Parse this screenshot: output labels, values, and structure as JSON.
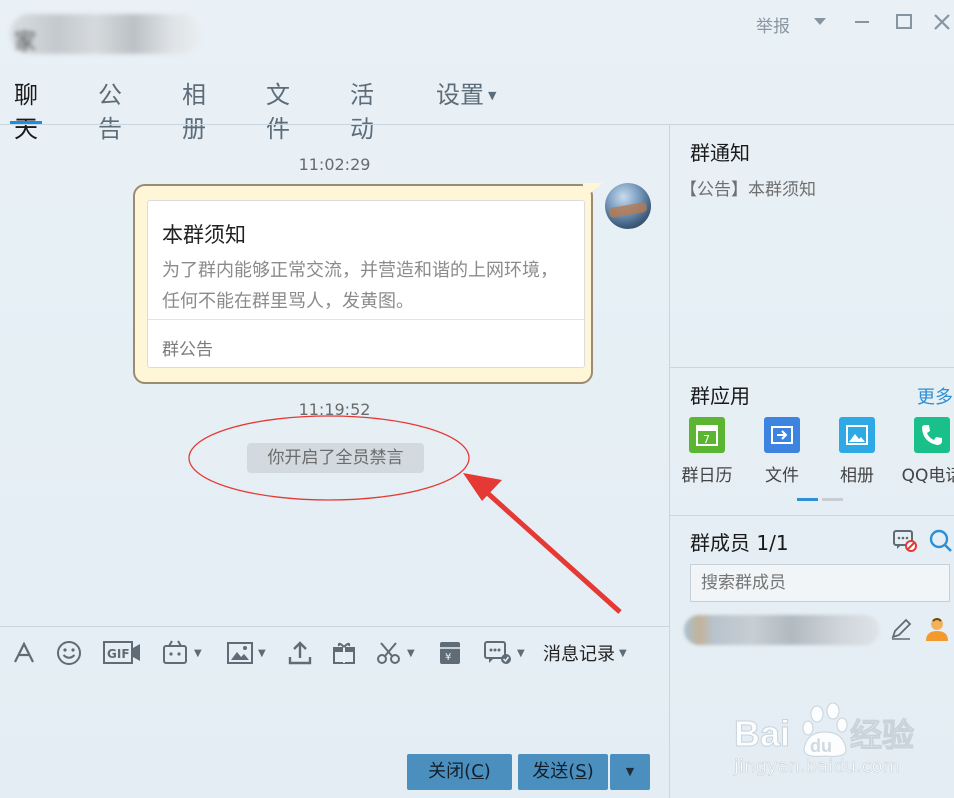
{
  "window": {
    "title_visible_char": "家",
    "report_label": "举报"
  },
  "tabs": [
    {
      "label": "聊天",
      "active": true
    },
    {
      "label": "公告"
    },
    {
      "label": "相册"
    },
    {
      "label": "文件"
    },
    {
      "label": "活动"
    },
    {
      "label": "设置"
    }
  ],
  "chat": {
    "time1": "11:02:29",
    "announcement": {
      "title": "本群须知",
      "body": "为了群内能够正常交流，并营造和谐的上网环境，任何不能在群里骂人，发黄图。",
      "footer": "群公告"
    },
    "time2": "11:19:52",
    "system_message": "你开启了全员禁言"
  },
  "toolbar": {
    "history_label": "消息记录"
  },
  "buttons": {
    "close_text": "关闭(",
    "close_key": "C",
    "close_end": ")",
    "send_text": "发送(",
    "send_key": "S",
    "send_end": ")"
  },
  "notice": {
    "title": "群通知",
    "item": "【公告】本群须知"
  },
  "apps": {
    "title": "群应用",
    "more": "更多",
    "items": [
      {
        "label": "群日历",
        "icon": "calendar-icon",
        "color": "#5cb531"
      },
      {
        "label": "文件",
        "icon": "file-transfer-icon",
        "color": "#3d84e0"
      },
      {
        "label": "相册",
        "icon": "photo-icon",
        "color": "#2fa8e6"
      },
      {
        "label": "QQ电话",
        "icon": "phone-icon",
        "color": "#19c08a"
      }
    ]
  },
  "members": {
    "title": "群成员 1/1",
    "search_placeholder": "搜索群成员"
  },
  "watermark": {
    "brand": "Bai",
    "brand2": "du",
    "suffix": "经验",
    "url": "jingyan.baidu.com"
  },
  "colors": {
    "accent": "#1e8fdc",
    "button": "#4b8fbf",
    "annotation": "#e53935"
  }
}
